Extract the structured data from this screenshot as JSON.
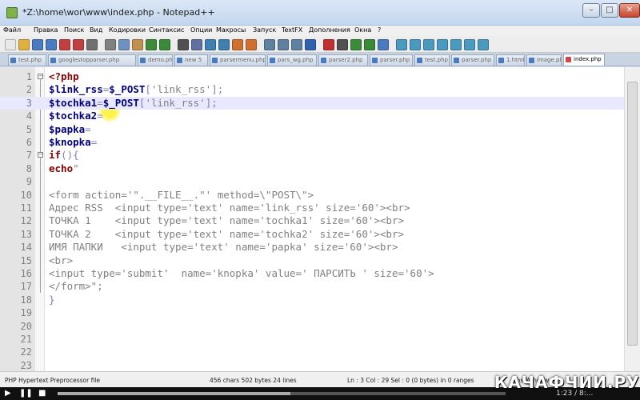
{
  "window": {
    "title": "*Z:\\home\\wor\\www\\index.php - Notepad++",
    "min_label": "–",
    "max_label": "□",
    "close_label": "✕"
  },
  "menu": [
    "Файл",
    "Правка",
    "Поиск",
    "Вид",
    "Кодировки",
    "Синтаксис",
    "Опции",
    "Макросы",
    "Запуск",
    "TextFX",
    "Дополнения",
    "Окна",
    "?"
  ],
  "toolbar_icons": [
    {
      "name": "new-file-icon",
      "color": "#e8e8e8"
    },
    {
      "name": "open-file-icon",
      "color": "#e0b040"
    },
    {
      "name": "save-icon",
      "color": "#4a7ac0"
    },
    {
      "name": "save-all-icon",
      "color": "#4a7ac0"
    },
    {
      "name": "close-icon",
      "color": "#c04040"
    },
    {
      "name": "close-all-icon",
      "color": "#c04040"
    },
    {
      "name": "print-icon",
      "color": "#707070"
    },
    {
      "name": "cut-icon",
      "color": "#808080"
    },
    {
      "name": "copy-icon",
      "color": "#7090c0"
    },
    {
      "name": "paste-icon",
      "color": "#c09050"
    },
    {
      "name": "undo-icon",
      "color": "#3a8a3a"
    },
    {
      "name": "redo-icon",
      "color": "#3a8a3a"
    },
    {
      "name": "find-icon",
      "color": "#505050"
    },
    {
      "name": "replace-icon",
      "color": "#6070a0"
    },
    {
      "name": "zoom-in-icon",
      "color": "#4080b0"
    },
    {
      "name": "zoom-out-icon",
      "color": "#4080b0"
    },
    {
      "name": "sync-v-icon",
      "color": "#d07030"
    },
    {
      "name": "sync-h-icon",
      "color": "#d07030"
    },
    {
      "name": "wrap-icon",
      "color": "#6080a0"
    },
    {
      "name": "all-chars-icon",
      "color": "#6080a0"
    },
    {
      "name": "indent-guide-icon",
      "color": "#6080a0"
    },
    {
      "name": "lang-icon",
      "color": "#3060b0"
    },
    {
      "name": "record-macro-icon",
      "color": "#c03030"
    },
    {
      "name": "stop-macro-icon",
      "color": "#505050"
    },
    {
      "name": "play-macro-icon",
      "color": "#3a8a3a"
    },
    {
      "name": "run-macro-icon",
      "color": "#3a8a3a"
    },
    {
      "name": "save-macro-icon",
      "color": "#4a7ac0"
    },
    {
      "name": "trim-icon",
      "color": "#4a9ac0"
    },
    {
      "name": "spell-icon",
      "color": "#4a9ac0"
    },
    {
      "name": "compare-icon",
      "color": "#4a9ac0"
    },
    {
      "name": "doc-map-icon",
      "color": "#4a9ac0"
    },
    {
      "name": "func-list-icon",
      "color": "#4a9ac0"
    },
    {
      "name": "monitor-icon",
      "color": "#4a9ac0"
    },
    {
      "name": "plugin-icon",
      "color": "#4a9ac0"
    }
  ],
  "tabs": [
    {
      "label": "test.php"
    },
    {
      "label": "googlestopparser.php"
    },
    {
      "label": "demo.php"
    },
    {
      "label": "new 5"
    },
    {
      "label": "parsermenu.php"
    },
    {
      "label": "pars_wg.php"
    },
    {
      "label": "parser2.php"
    },
    {
      "label": "parser.php"
    },
    {
      "label": "test.php"
    },
    {
      "label": "parser.php"
    },
    {
      "label": "1.html"
    },
    {
      "label": "image.php"
    },
    {
      "label": "index.php",
      "active": true
    }
  ],
  "code_lines": [
    {
      "n": "1",
      "text": "<?php"
    },
    {
      "n": "2",
      "text": "$link_rss=$_POST['link_rss'];"
    },
    {
      "n": "3",
      "text": "$tochka1=$_POST['link_rss'];"
    },
    {
      "n": "4",
      "text": "$tochka2="
    },
    {
      "n": "5",
      "text": "$papka="
    },
    {
      "n": "6",
      "text": "$knopka="
    },
    {
      "n": "7",
      "text": "if(){"
    },
    {
      "n": "8",
      "text": "echo\""
    },
    {
      "n": "9",
      "text": ""
    },
    {
      "n": "10",
      "text": "<form action='\".__FILE__.\"' method=\\\"POST\\\">"
    },
    {
      "n": "11",
      "text": "Адрес RSS  <input type='text' name='link_rss' size='60'><br>"
    },
    {
      "n": "12",
      "text": "ТОЧКА 1    <input type='text' name='tochka1' size='60'><br>"
    },
    {
      "n": "13",
      "text": "ТОЧКА 2    <input type='text' name='tochka2' size='60'><br>"
    },
    {
      "n": "14",
      "text": "ИМЯ ПАПКИ   <input type='text' name='papka' size='60'><br>"
    },
    {
      "n": "15",
      "text": "<br>"
    },
    {
      "n": "16",
      "text": "<input type='submit'  name='knopka' value=' ПАРСИТЬ ' size='60'>"
    },
    {
      "n": "17",
      "text": "</form>\";"
    },
    {
      "n": "18",
      "text": "}"
    },
    {
      "n": "19",
      "text": ""
    },
    {
      "n": "20",
      "text": ""
    },
    {
      "n": "21",
      "text": ""
    },
    {
      "n": "22",
      "text": ""
    },
    {
      "n": "23",
      "text": ""
    }
  ],
  "status": {
    "file_type": "PHP Hypertext Preprocessor file",
    "length": "456 chars  502 bytes  24 lines",
    "position": "Ln : 3   Col : 29   Sel : 0 (0 bytes) in 0 ranges",
    "eol": "Dos\\Windows"
  },
  "player": {
    "play_label": "▶",
    "pause_label": "❚❚",
    "stop_label": "■",
    "time": "1:23 / 8:...",
    "progress": 0.52
  },
  "watermark": "КАЧАФЧИИ.РУ"
}
